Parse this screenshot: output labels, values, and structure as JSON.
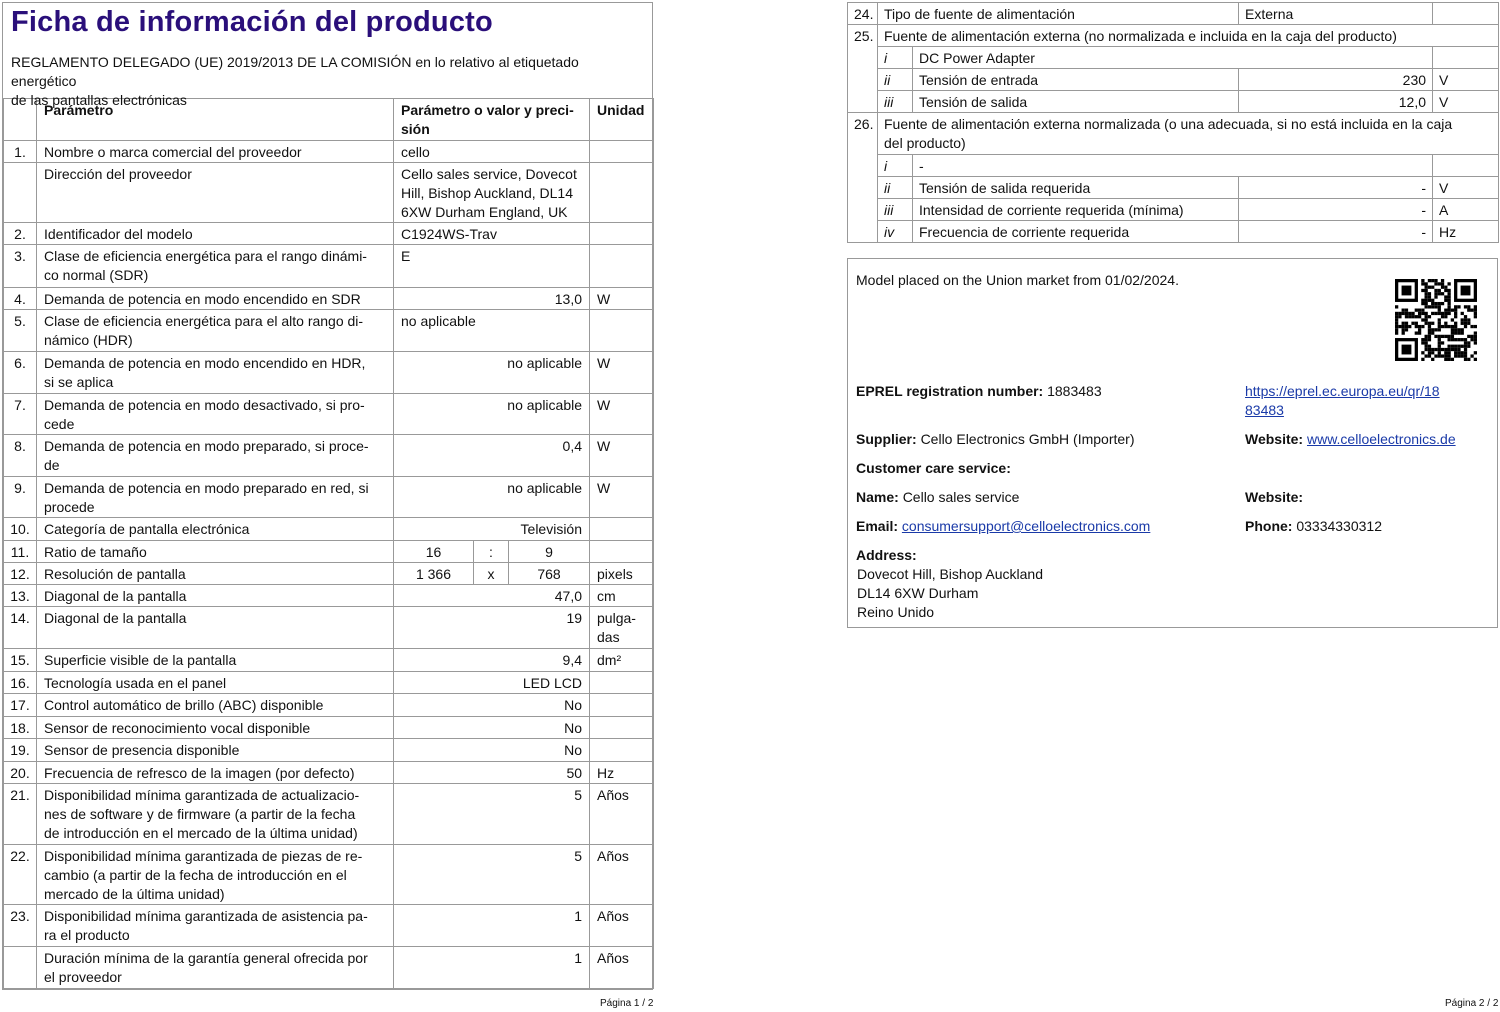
{
  "left": {
    "title": "Ficha de información del producto",
    "subtitle": "REGLAMENTO DELEGADO (UE) 2019/2013 DE LA COMISIÓN en lo relativo al etiquetado energético\nde las pantallas electrónicas",
    "headers": {
      "param": "Parámetro",
      "value": "Parámetro o valor y preci-\nsión",
      "unit": "Unidad"
    },
    "rows": [
      {
        "n": "1.",
        "p": "Nombre o marca comercial del proveedor",
        "v": "cello",
        "u": ""
      },
      {
        "n": "",
        "p": "Dirección del proveedor",
        "v": "Cello sales service, Dovecot\nHill, Bishop Auckland, DL14\n6XW Durham England, UK",
        "u": ""
      },
      {
        "n": "2.",
        "p": "Identificador del modelo",
        "v": "C1924WS-Trav",
        "u": ""
      },
      {
        "n": "3.",
        "p": "Clase de eficiencia energética para el rango dinámi-\nco normal (SDR)",
        "v": "E",
        "u": ""
      },
      {
        "n": "4.",
        "p": "Demanda de potencia en modo encendido en SDR",
        "v": "13,0",
        "u": "W"
      },
      {
        "n": "5.",
        "p": "Clase de eficiencia energética para el alto rango di-\nnámico (HDR)",
        "v": "no aplicable",
        "u": ""
      },
      {
        "n": "6.",
        "p": "Demanda de potencia en modo encendido en HDR,\nsi se aplica",
        "v": "no aplicable",
        "u": "W"
      },
      {
        "n": "7.",
        "p": "Demanda de potencia en modo desactivado, si pro-\ncede",
        "v": "no aplicable",
        "u": "W"
      },
      {
        "n": "8.",
        "p": "Demanda de potencia en modo preparado, si proce-\nde",
        "v": "0,4",
        "u": "W"
      },
      {
        "n": "9.",
        "p": "Demanda de potencia en modo preparado en red, si\nprocede",
        "v": "no aplicable",
        "u": "W"
      },
      {
        "n": "10.",
        "p": "Categoría de pantalla electrónica",
        "v": "Televisión",
        "u": ""
      },
      {
        "n": "11.",
        "p": "Ratio de tamaño",
        "a": "16",
        "s": ":",
        "b": "9",
        "u": ""
      },
      {
        "n": "12.",
        "p": "Resolución de pantalla",
        "a": "1 366",
        "s": "x",
        "b": "768",
        "u": "pixels"
      },
      {
        "n": "13.",
        "p": "Diagonal de la pantalla",
        "v": "47,0",
        "u": "cm"
      },
      {
        "n": "14.",
        "p": "Diagonal de la pantalla",
        "v": "19",
        "u": "pulga-\ndas"
      },
      {
        "n": "15.",
        "p": "Superficie visible de la pantalla",
        "v": "9,4",
        "u": "dm²"
      },
      {
        "n": "16.",
        "p": "Tecnología usada en el panel",
        "v": "LED LCD",
        "u": ""
      },
      {
        "n": "17.",
        "p": "Control automático de brillo (ABC) disponible",
        "v": "No",
        "u": ""
      },
      {
        "n": "18.",
        "p": "Sensor de reconocimiento vocal disponible",
        "v": "No",
        "u": ""
      },
      {
        "n": "19.",
        "p": "Sensor de presencia disponible",
        "v": "No",
        "u": ""
      },
      {
        "n": "20.",
        "p": "Frecuencia de refresco de la imagen (por defecto)",
        "v": "50",
        "u": "Hz"
      },
      {
        "n": "21.",
        "p": "Disponibilidad mínima garantizada de actualizacio-\nnes de software y de firmware (a partir de la fecha\nde introducción en el mercado de la última unidad)",
        "v": "5",
        "u": "Años"
      },
      {
        "n": "22.",
        "p": "Disponibilidad mínima garantizada de piezas de re-\ncambio (a partir de la fecha de introducción en el\nmercado de la última unidad)",
        "v": "5",
        "u": "Años"
      },
      {
        "n": "23.",
        "p": "Disponibilidad mínima garantizada de asistencia pa-\nra el producto",
        "v": "1",
        "u": "Años"
      },
      {
        "n": "",
        "p": "Duración mínima de la garantía general ofrecida por\nel proveedor",
        "v": "1",
        "u": "Años"
      }
    ],
    "footer": "Página 1 / 2"
  },
  "right": {
    "r24": {
      "n": "24.",
      "p": "Tipo de fuente de alimentación",
      "v": "Externa"
    },
    "r25": {
      "n": "25.",
      "p": "Fuente de alimentación externa (no normalizada e incluida en la caja del producto)",
      "subs": [
        {
          "k": "i",
          "p": "DC Power Adapter",
          "v": "",
          "u": ""
        },
        {
          "k": "ii",
          "p": "Tensión de entrada",
          "v": "230",
          "u": "V"
        },
        {
          "k": "iii",
          "p": "Tensión de salida",
          "v": "12,0",
          "u": "V"
        }
      ]
    },
    "r26": {
      "n": "26.",
      "p": "Fuente de alimentación externa normalizada (o una adecuada, si no está incluida en la caja\ndel producto)",
      "subs": [
        {
          "k": "i",
          "p": "-",
          "v": "",
          "u": ""
        },
        {
          "k": "ii",
          "p": "Tensión de salida requerida",
          "v": "-",
          "u": "V"
        },
        {
          "k": "iii",
          "p": "Intensidad de corriente requerida (mínima)",
          "v": "-",
          "u": "A"
        },
        {
          "k": "iv",
          "p": "Frecuencia de corriente requerida",
          "v": "-",
          "u": "Hz"
        }
      ]
    },
    "info": {
      "placed": "Model placed on the Union market from 01/02/2024.",
      "eprel_label": "EPREL registration number:",
      "eprel_value": "1883483",
      "eprel_link": "https://eprel.ec.europa.eu/qr/18\n83483",
      "supplier_label": "Supplier:",
      "supplier_value": "Cello Electronics GmbH (Importer)",
      "website_label": "Website:",
      "website_value": "www.celloelectronics.de",
      "care_label": "Customer care service:",
      "name_label": "Name:",
      "name_value": "Cello sales service",
      "website2_label": "Website:",
      "email_label": "Email:",
      "email_value": "consumersupport@celloelectronics.com",
      "phone_label": "Phone:",
      "phone_value": "03334330312",
      "address_label": "Address:",
      "address_value": "Dovecot Hill, Bishop Auckland\nDL14 6XW Durham\nReino Unido"
    },
    "footer": "Página 2 / 2"
  }
}
